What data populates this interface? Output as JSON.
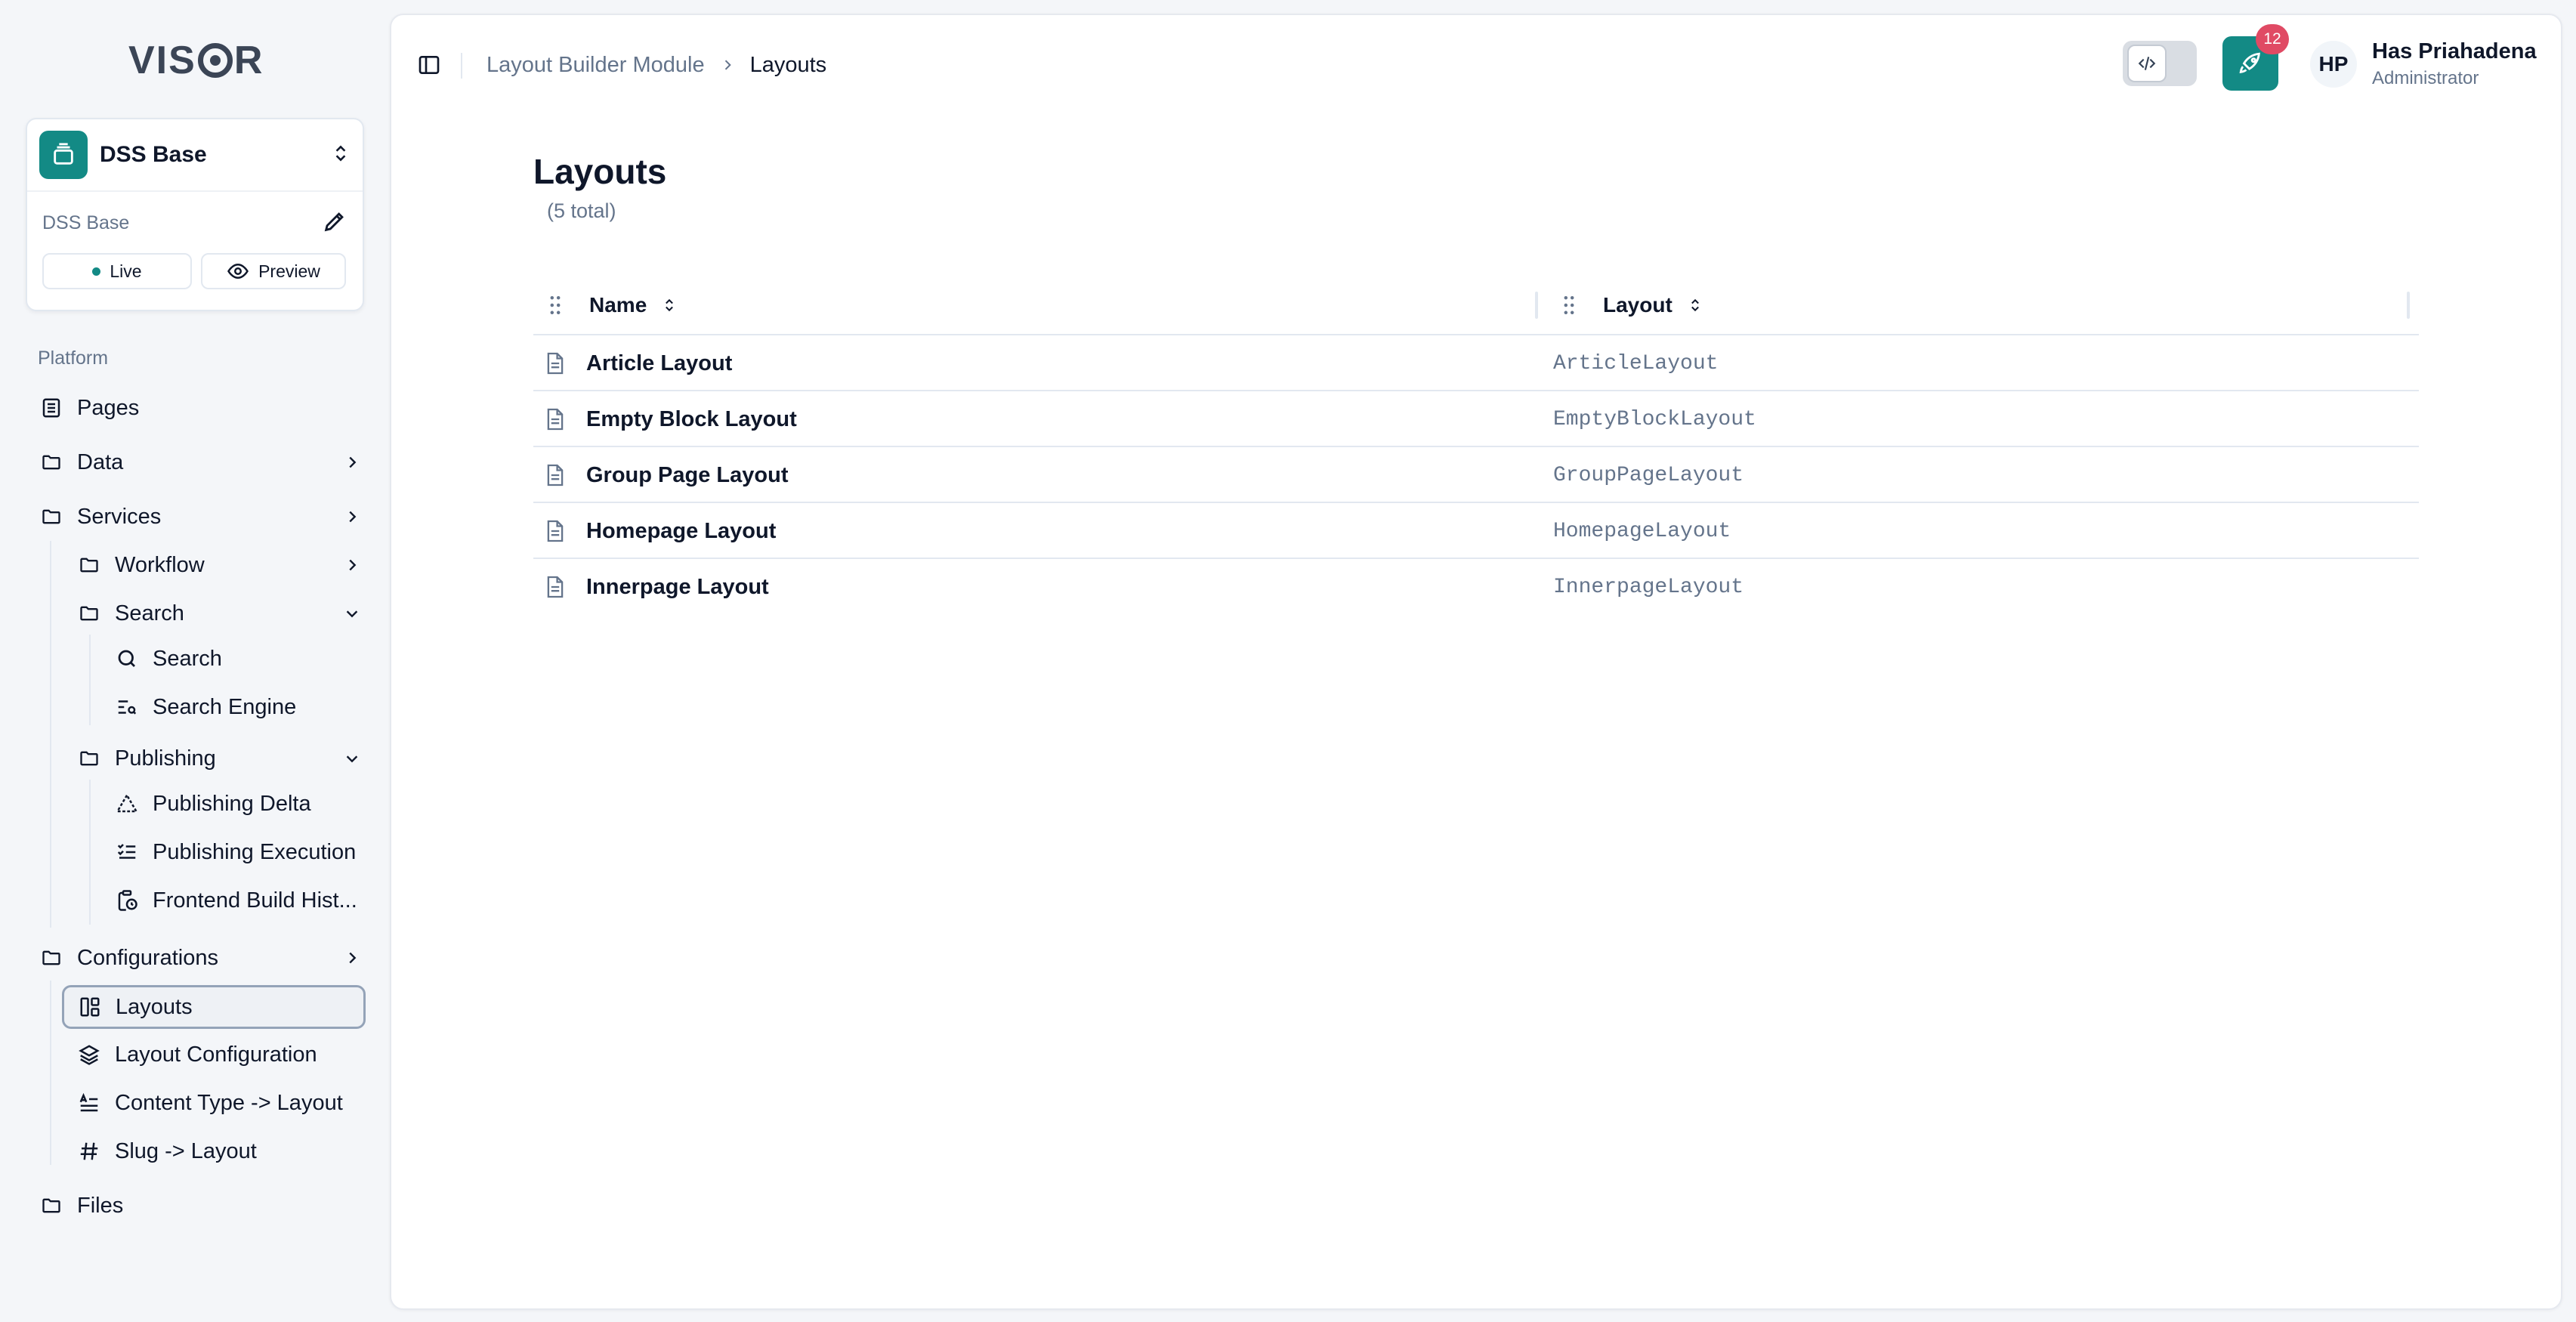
{
  "app": {
    "logo": "VISOR"
  },
  "site": {
    "name": "DSS Base",
    "sub_label": "DSS Base",
    "live_label": "Live",
    "preview_label": "Preview",
    "accent": "#138a85"
  },
  "sidebar": {
    "section_label": "Platform",
    "items": {
      "pages": "Pages",
      "data": "Data",
      "services": "Services",
      "workflow": "Workflow",
      "search_group": "Search",
      "search": "Search",
      "search_engine": "Search Engine",
      "publishing": "Publishing",
      "publishing_delta": "Publishing Delta",
      "publishing_execution": "Publishing Execution",
      "frontend_build": "Frontend Build Hist...",
      "configurations": "Configurations",
      "layouts": "Layouts",
      "layout_configuration": "Layout Configuration",
      "content_type_layout": "Content Type -> Layout",
      "slug_layout": "Slug -> Layout",
      "files": "Files"
    }
  },
  "header": {
    "breadcrumb": {
      "parent": "Layout Builder Module",
      "current": "Layouts"
    },
    "notification_count": "12",
    "user": {
      "initials": "HP",
      "name": "Has Priahadena",
      "role": "Administrator"
    }
  },
  "page": {
    "title": "Layouts",
    "count": "(5 total)"
  },
  "table": {
    "columns": {
      "name": "Name",
      "layout": "Layout"
    },
    "rows": [
      {
        "name": "Article Layout",
        "layout": "ArticleLayout"
      },
      {
        "name": "Empty Block Layout",
        "layout": "EmptyBlockLayout"
      },
      {
        "name": "Group Page Layout",
        "layout": "GroupPageLayout"
      },
      {
        "name": "Homepage Layout",
        "layout": "HomepageLayout"
      },
      {
        "name": "Innerpage Layout",
        "layout": "InnerpageLayout"
      }
    ]
  }
}
